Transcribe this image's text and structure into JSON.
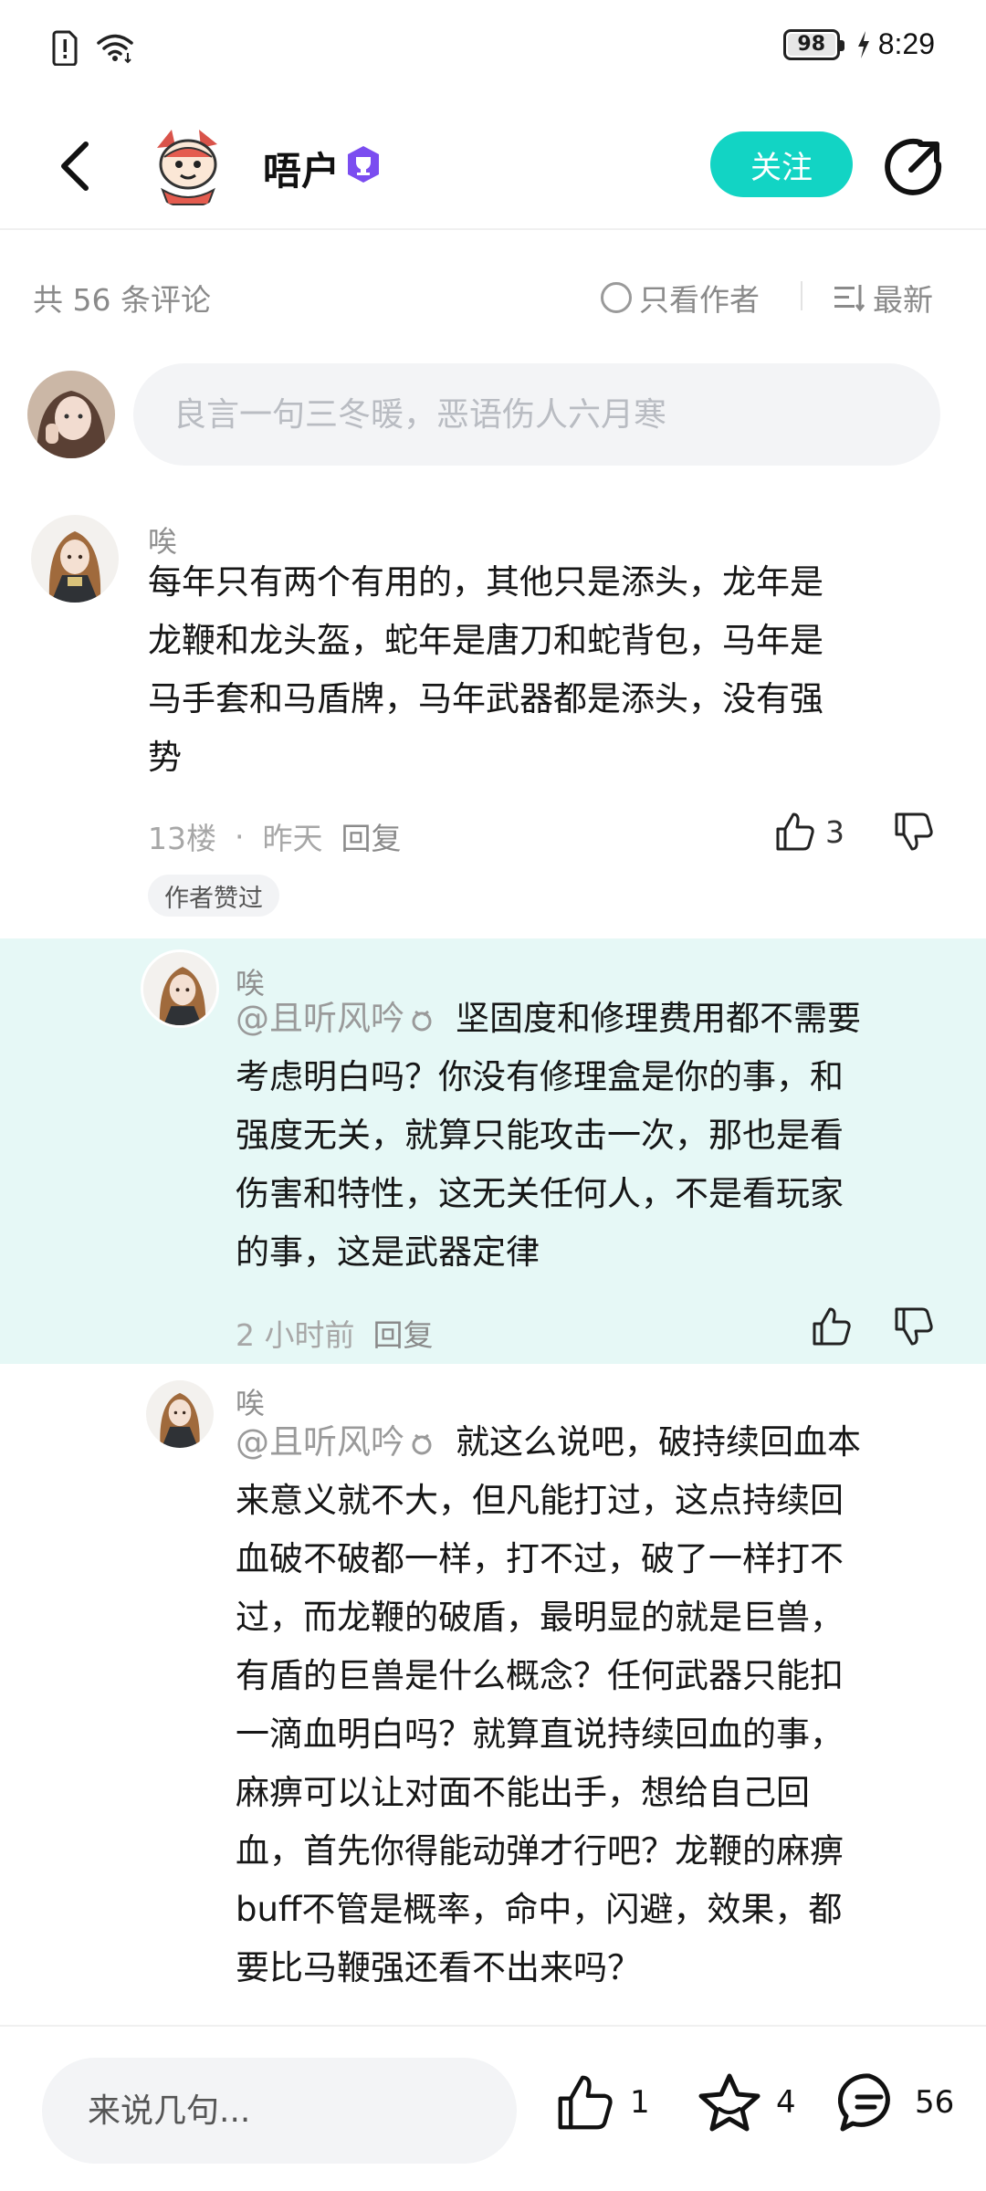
{
  "status_bar": {
    "battery": "98",
    "time": "8:29"
  },
  "header": {
    "title": "唔户",
    "follow_label": "关注"
  },
  "filter": {
    "comment_count": "共 56 条评论",
    "only_author": "只看作者",
    "sort": "最新"
  },
  "compose": {
    "placeholder": "良言一句三冬暖，恶语伤人六月寒"
  },
  "comments": [
    {
      "author": "唉",
      "lines": [
        "每年只有两个有用的，其他只是添头，龙年是",
        "龙鞭和龙头盔，蛇年是唐刀和蛇背包，马年是",
        "马手套和马盾牌，马年武器都是添头，没有强",
        "势"
      ],
      "floor": "13楼",
      "dot": "·",
      "time": "昨天",
      "reply": "回复",
      "likes": "3",
      "author_liked": "作者赞过"
    }
  ],
  "replies": [
    {
      "author": "唉",
      "mention": "@且听风吟",
      "first_line": "坚固度和修理费用都不需要",
      "lines": [
        "考虑明白吗？你没有修理盒是你的事，和",
        "强度无关，就算只能攻击一次，那也是看",
        "伤害和特性，这无关任何人，不是看玩家",
        "的事，这是武器定律"
      ],
      "time": "2 小时前",
      "reply": "回复"
    },
    {
      "author": "唉",
      "mention": "@且听风吟",
      "first_line": "就这么说吧，破持续回血本",
      "lines": [
        "来意义就不大，但凡能打过，这点持续回",
        "血破不破都一样，打不过，破了一样打不",
        "过，而龙鞭的破盾，最明显的就是巨兽，",
        "有盾的巨兽是什么概念？任何武器只能扣",
        "一滴血明白吗？就算直说持续回血的事，",
        "麻痹可以让对面不能出手，想给自己回",
        "血，首先你得能动弹才行吧？龙鞭的麻痹",
        "buff不管是概率，命中，闪避，效果，都",
        "要比马鞭强还看不出来吗？"
      ]
    }
  ],
  "bottom_bar": {
    "placeholder": "来说几句...",
    "likes": "1",
    "favorites": "4",
    "comments": "56"
  },
  "colors": {
    "accent": "#12d4c4",
    "highlight": "#e6f8f6",
    "badge": "#7b4df0"
  }
}
